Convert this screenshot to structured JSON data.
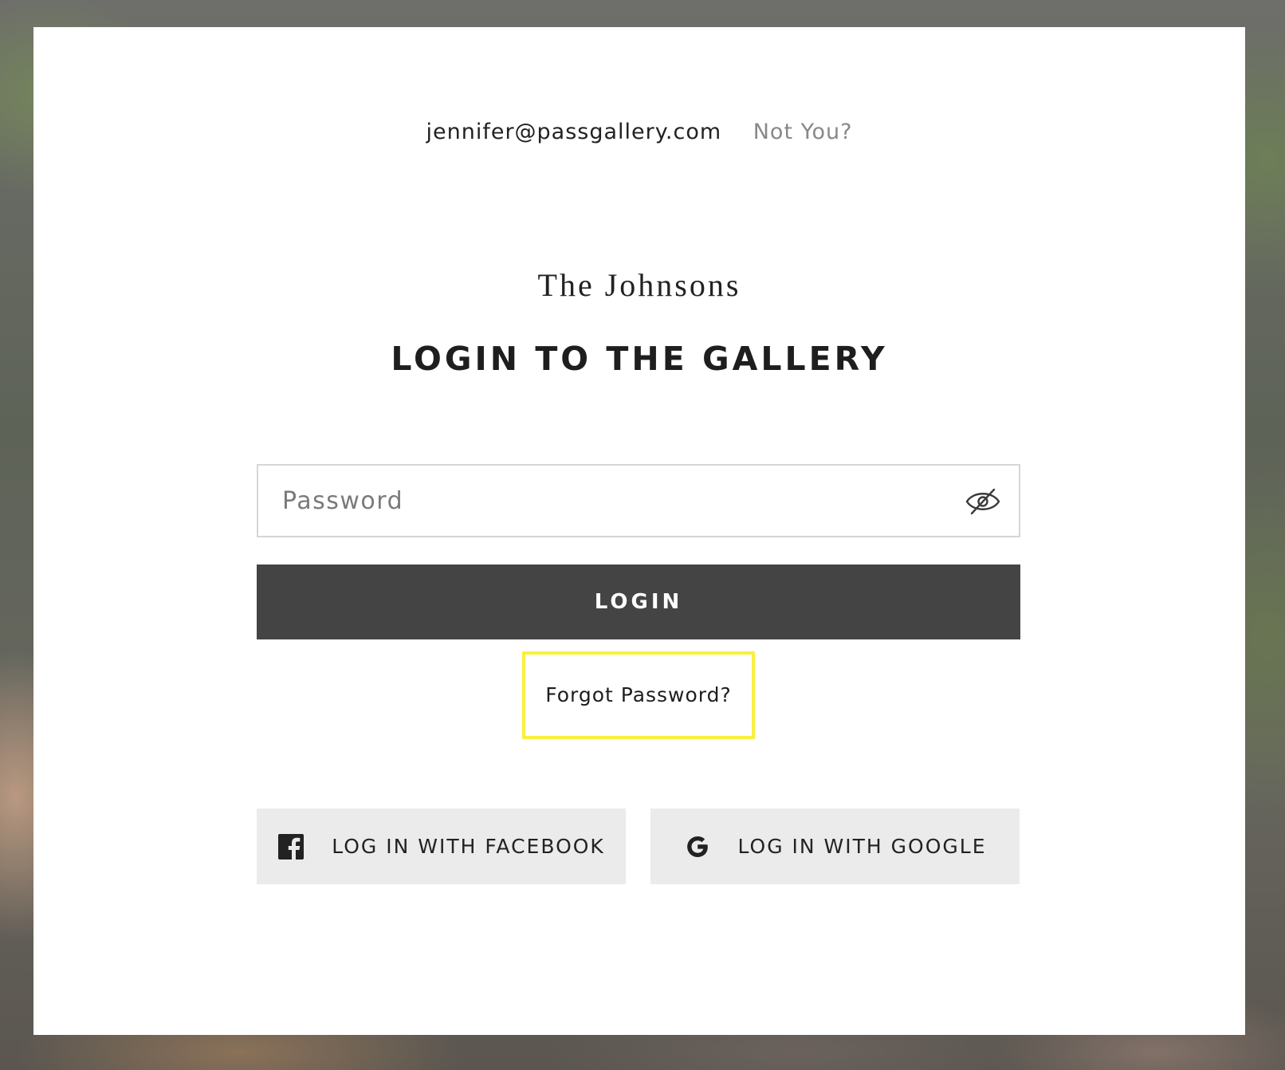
{
  "account": {
    "email": "jennifer@passgallery.com",
    "not_you_label": "Not You?"
  },
  "gallery": {
    "name": "The Johnsons"
  },
  "login_form": {
    "title": "LOGIN TO THE GALLERY",
    "password_placeholder": "Password",
    "password_value": "",
    "show_password_icon": "eye-slash-icon",
    "submit_label": "LOGIN",
    "forgot_password_label": "Forgot Password?"
  },
  "social_login": {
    "facebook_label": "LOG IN WITH FACEBOOK",
    "facebook_icon": "facebook-icon",
    "google_label": "LOG IN WITH GOOGLE",
    "google_icon": "google-icon"
  },
  "colors": {
    "login_button_bg": "#444444",
    "social_button_bg": "#ebebeb",
    "forgot_highlight": "#f8f040",
    "muted_text": "#888888"
  }
}
